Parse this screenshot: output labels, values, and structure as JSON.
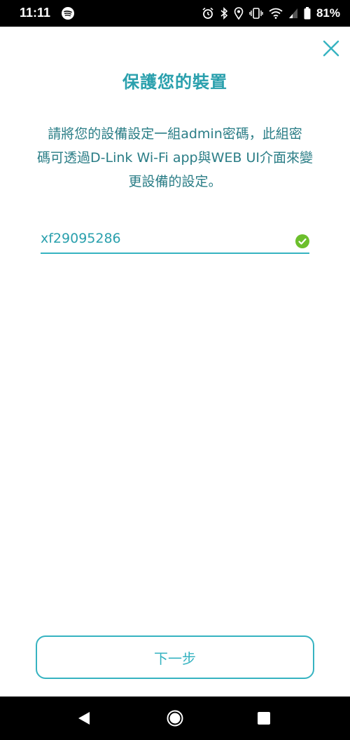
{
  "status_bar": {
    "time": "11:11",
    "battery_percent": "81%",
    "icons": [
      "spotify-icon",
      "alarm-icon",
      "bluetooth-icon",
      "location-icon",
      "vibrate-icon",
      "wifi-icon",
      "signal-icon",
      "battery-icon"
    ]
  },
  "page": {
    "title": "保護您的裝置",
    "description_lines": [
      "請將您的設備設定一組admin密碼，此組密",
      "碼可透過D-Link Wi-Fi app與WEB UI介面來變",
      "更設備的設定。"
    ]
  },
  "password_field": {
    "value": "xf29095286",
    "valid": true
  },
  "next_button": {
    "label": "下一步"
  },
  "nav_bar": {
    "icons": [
      "back-icon",
      "home-icon",
      "recents-icon"
    ]
  },
  "colors": {
    "accent": "#36b3c1",
    "title_text": "#2aa0ad",
    "body_text": "#2a7d86",
    "valid_check": "#6cbf2c"
  }
}
